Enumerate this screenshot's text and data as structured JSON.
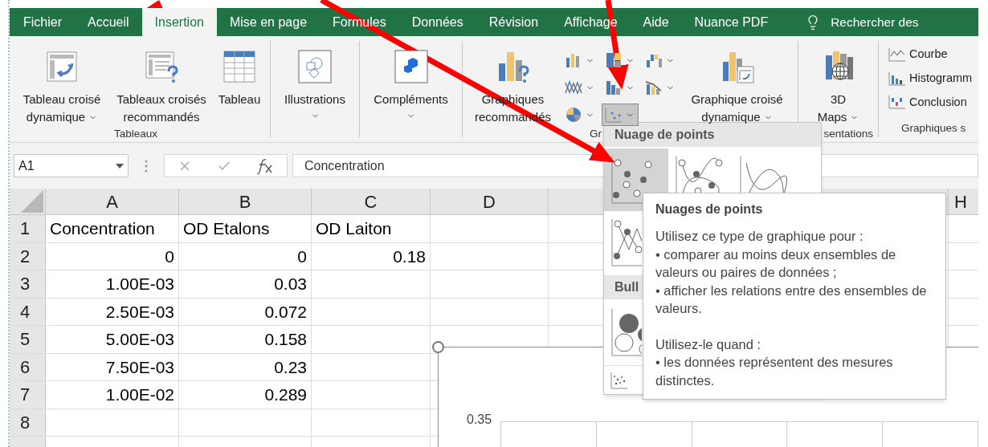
{
  "tabs": [
    {
      "label": "Fichier",
      "selected": false
    },
    {
      "label": "Accueil",
      "selected": false
    },
    {
      "label": "Insertion",
      "selected": true
    },
    {
      "label": "Mise en page",
      "selected": false
    },
    {
      "label": "Formules",
      "selected": false
    },
    {
      "label": "Données",
      "selected": false
    },
    {
      "label": "Révision",
      "selected": false
    },
    {
      "label": "Affichage",
      "selected": false
    },
    {
      "label": "Aide",
      "selected": false
    },
    {
      "label": "Nuance PDF",
      "selected": false
    }
  ],
  "search": {
    "text": "Rechercher des"
  },
  "ribbon_groups": [
    {
      "label": "Tableaux",
      "buttons": [
        {
          "kind": "pivot-table",
          "lines": [
            "Tableau croisé",
            "dynamique"
          ],
          "menu": true
        },
        {
          "kind": "recommended-pivot",
          "lines": [
            "Tableaux croisés",
            "recommandés"
          ],
          "menu": false
        },
        {
          "kind": "table",
          "lines": [
            "Tableau"
          ],
          "menu": false
        }
      ]
    },
    {
      "buttons": [
        {
          "kind": "illustrations",
          "lines": [
            "Illustrations"
          ],
          "menu": true
        }
      ]
    },
    {
      "buttons": [
        {
          "kind": "addins",
          "lines": [
            "Compléments"
          ],
          "menu": true
        }
      ]
    },
    {
      "label": "Gr",
      "buttons": [
        {
          "kind": "recommended-charts",
          "lines": [
            "Graphiques",
            "recommandés"
          ],
          "menu": false
        },
        {
          "kind": "chart-grid"
        },
        {
          "kind": "pivot-chart",
          "lines": [
            "Graphique croisé",
            "dynamique"
          ],
          "menu": true
        }
      ]
    },
    {
      "label": "sentations",
      "buttons": [
        {
          "kind": "maps",
          "lines": [
            "3D",
            "Maps"
          ],
          "menu": true
        }
      ]
    },
    {
      "label": "Graphiques s",
      "sparklines": [
        {
          "kind": "line",
          "label": "Courbe"
        },
        {
          "kind": "column",
          "label": "Histogramm"
        },
        {
          "kind": "winloss",
          "label": "Conclusion"
        }
      ]
    }
  ],
  "chart_buttons": [
    {
      "kind": "column",
      "selected": false
    },
    {
      "kind": "hierarchy",
      "selected": false
    },
    {
      "kind": "waterfall",
      "selected": false
    },
    {
      "kind": "line",
      "selected": false
    },
    {
      "kind": "statistic",
      "selected": false
    },
    {
      "kind": "combo",
      "selected": false
    },
    {
      "kind": "pie",
      "selected": false
    },
    {
      "kind": "scatter",
      "selected": true
    }
  ],
  "formula_bar": {
    "name_box": "A1",
    "value": "Concentration"
  },
  "column_headers": [
    "A",
    "B",
    "C",
    "D"
  ],
  "column_headers_right": [
    "H"
  ],
  "rows": [
    {
      "number": "1",
      "kind": "text",
      "cells": [
        "Concentration",
        "OD Etalons",
        "OD Laiton"
      ]
    },
    {
      "number": "2",
      "kind": "number",
      "cells": [
        "0",
        "0",
        "0.18"
      ]
    },
    {
      "number": "3",
      "kind": "number",
      "cells": [
        "1.00E-03",
        "0.03"
      ]
    },
    {
      "number": "4",
      "kind": "number",
      "cells": [
        "2.50E-03",
        "0.072"
      ]
    },
    {
      "number": "5",
      "kind": "number",
      "cells": [
        "5.00E-03",
        "0.158"
      ]
    },
    {
      "number": "6",
      "kind": "number",
      "cells": [
        "7.50E-03",
        "0.23"
      ]
    },
    {
      "number": "7",
      "kind": "number",
      "cells": [
        "1.00E-02",
        "0.289"
      ]
    },
    {
      "number": "8",
      "kind": "number"
    }
  ],
  "chart": {
    "y_tick": "0.35"
  },
  "dropdown": {
    "sections": [
      {
        "title": "Nuage de points",
        "items": [
          {
            "kind": "scatter",
            "selected": true
          },
          {
            "kind": "smooth-markers",
            "selected": false
          },
          {
            "kind": "smooth-lines",
            "selected": false
          },
          {
            "kind": "straight-markers",
            "selected": false
          }
        ]
      },
      {
        "title": "Bull",
        "items": [
          {
            "kind": "bubble",
            "selected": false
          }
        ]
      }
    ],
    "footer": {
      "kind": "more-charts"
    }
  },
  "tooltip": {
    "title": "Nuages de points",
    "paragraphs": [
      "Utilisez ce type de graphique pour :",
      "• comparer au moins deux ensembles de valeurs ou paires de données ;",
      "• afficher les relations entre des ensembles de valeurs.",
      "Utilisez-le quand :",
      "• les données représentent des mesures distinctes."
    ]
  }
}
